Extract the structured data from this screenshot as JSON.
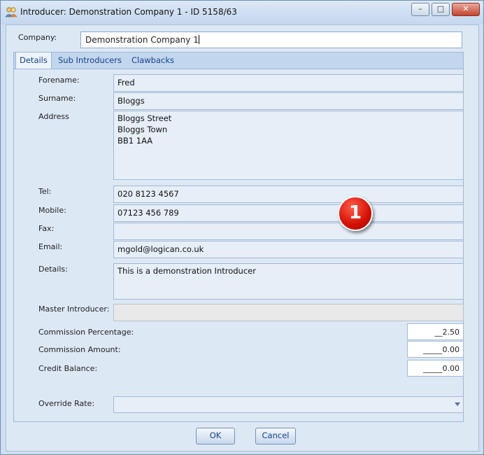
{
  "window": {
    "title": "Introducer: Demonstration Company 1 - ID 5158/63",
    "controls": {
      "minimize": "–",
      "maximize": "□",
      "close": "✕"
    }
  },
  "company": {
    "label": "Company:",
    "value": "Demonstration Company 1"
  },
  "tabs": [
    {
      "label": "Details",
      "active": true
    },
    {
      "label": "Sub Introducers",
      "active": false
    },
    {
      "label": "Clawbacks",
      "active": false
    }
  ],
  "form": {
    "forename": {
      "label": "Forename:",
      "value": "Fred"
    },
    "surname": {
      "label": "Surname:",
      "value": "Bloggs"
    },
    "address": {
      "label": "Address",
      "value": "Bloggs Street\nBloggs Town\nBB1 1AA"
    },
    "tel": {
      "label": "Tel:",
      "value": "020 8123 4567"
    },
    "mobile": {
      "label": "Mobile:",
      "value": "07123 456 789"
    },
    "fax": {
      "label": "Fax:",
      "value": ""
    },
    "email": {
      "label": "Email:",
      "value": "mgold@logican.co.uk"
    },
    "details": {
      "label": "Details:",
      "value": "This is a demonstration Introducer"
    },
    "master_introducer": {
      "label": "Master Introducer:",
      "value": ""
    },
    "commission_percentage": {
      "label": "Commission Percentage:",
      "value": "__2.50"
    },
    "commission_amount": {
      "label": "Commission Amount:",
      "value": "_____0.00"
    },
    "credit_balance": {
      "label": "Credit Balance:",
      "value": "_____0.00"
    },
    "override_rate": {
      "label": "Override Rate:",
      "value": ""
    }
  },
  "annotation": {
    "number": "1",
    "color": "#d31005"
  },
  "buttons": {
    "ok": "OK",
    "cancel": "Cancel"
  },
  "colors": {
    "accent": "#15428b",
    "panel": "#dde8f5",
    "tab_strip": "#c2d6ee"
  }
}
